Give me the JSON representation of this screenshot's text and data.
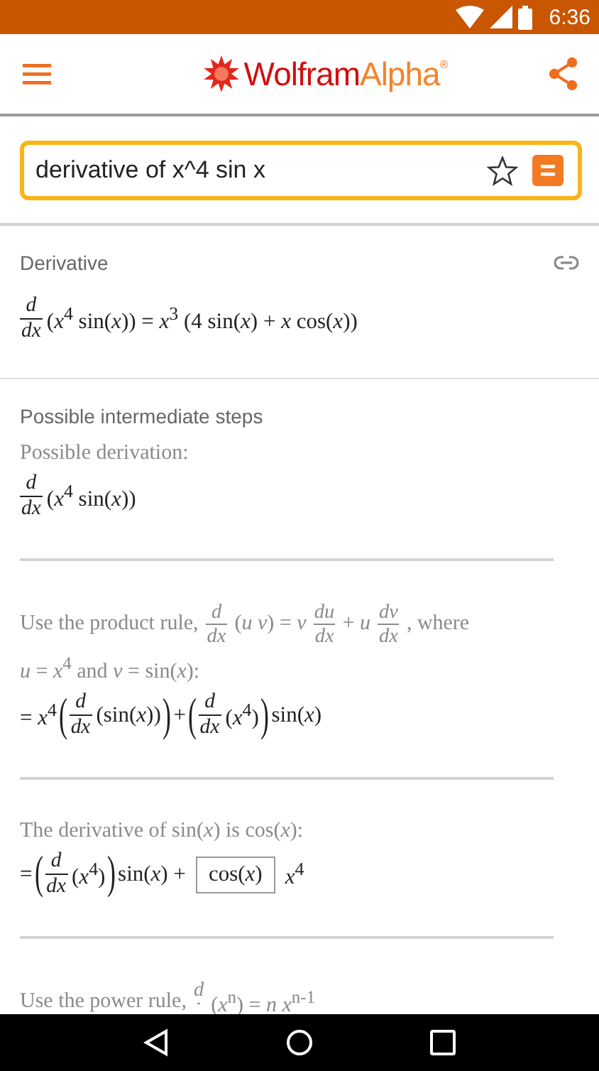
{
  "status_bar": {
    "time": "6:36"
  },
  "app_bar": {
    "logo_first": "Wolfram",
    "logo_second": "Alpha",
    "logo_mark": "®"
  },
  "search": {
    "value": "derivative of x^4 sin x"
  },
  "pods": [
    {
      "title": "Derivative",
      "link": true,
      "lines": [
        {
          "kind": "result",
          "pieces": [
            {
              "kind": "frac",
              "num": "*d*",
              "den": "*dx*"
            },
            {
              "kind": "text",
              "text": "(*x*$^{4}$ sin(*x*)) = *x*$^{3}$ (4 sin(*x*) + *x* cos(*x*))"
            }
          ]
        }
      ]
    },
    {
      "title": "Possible intermediate steps",
      "steps": [
        {
          "lines": [
            {
              "kind": "prose",
              "pieces": [
                {
                  "kind": "text",
                  "text": "Possible derivation:"
                }
              ]
            },
            {
              "kind": "result",
              "pieces": [
                {
                  "kind": "frac",
                  "num": "*d*",
                  "den": "*dx*"
                },
                {
                  "kind": "text",
                  "text": "(*x*$^{4}$ sin(*x*))"
                }
              ]
            }
          ]
        },
        {
          "lines": [
            {
              "kind": "prose",
              "pieces": [
                {
                  "kind": "text",
                  "text": "Use the product rule,"
                },
                {
                  "kind": "frac",
                  "num": "*d*",
                  "den": "*dx*"
                },
                {
                  "kind": "text",
                  "text": "(*u v*) = *v*"
                },
                {
                  "kind": "frac",
                  "num": "*du*",
                  "den": "*dx*"
                },
                {
                  "kind": "text",
                  "text": "+ *u*"
                },
                {
                  "kind": "frac",
                  "num": "*dv*",
                  "den": "*dx*"
                },
                {
                  "kind": "text",
                  "text": ", where"
                }
              ]
            },
            {
              "kind": "prose",
              "pieces": [
                {
                  "kind": "text",
                  "text": "*u* = *x*$^{4}$ and *v* = sin(*x*):"
                }
              ]
            },
            {
              "kind": "result",
              "pieces": [
                {
                  "kind": "text",
                  "text": "= *x*$^{4}$"
                },
                {
                  "kind": "bracket",
                  "text": "("
                },
                {
                  "kind": "frac",
                  "num": "*d*",
                  "den": "*dx*"
                },
                {
                  "kind": "text",
                  "text": "(sin(*x*))"
                },
                {
                  "kind": "bracket",
                  "text": ")"
                },
                {
                  "kind": "text",
                  "text": "+"
                },
                {
                  "kind": "bracket",
                  "text": "("
                },
                {
                  "kind": "frac",
                  "num": "*d*",
                  "den": "*dx*"
                },
                {
                  "kind": "text",
                  "text": "(*x*$^{4}$)"
                },
                {
                  "kind": "bracket",
                  "text": ")"
                },
                {
                  "kind": "text",
                  "text": "sin(*x*)"
                }
              ]
            }
          ]
        },
        {
          "lines": [
            {
              "kind": "prose",
              "pieces": [
                {
                  "kind": "text",
                  "text": "The derivative of sin(*x*) is cos(*x*):"
                }
              ]
            },
            {
              "kind": "result",
              "pieces": [
                {
                  "kind": "text",
                  "text": "="
                },
                {
                  "kind": "bracket",
                  "text": "("
                },
                {
                  "kind": "frac",
                  "num": "*d*",
                  "den": "*dx*"
                },
                {
                  "kind": "text",
                  "text": "(*x*$^{4}$)"
                },
                {
                  "kind": "bracket",
                  "text": ")"
                },
                {
                  "kind": "text",
                  "text": "sin(*x*) +"
                },
                {
                  "kind": "boxed",
                  "text": "cos(*x*)"
                },
                {
                  "kind": "text",
                  "text": "*x*$^{4}$"
                }
              ]
            }
          ]
        },
        {
          "lines": [
            {
              "kind": "prose",
              "pieces": [
                {
                  "kind": "text",
                  "text": "Use the power rule,"
                },
                {
                  "kind": "frac",
                  "num": "*d*"
                },
                {
                  "kind": "text",
                  "text": "(*x*$^{n}$) = *n x*$^{n-1}$"
                }
              ]
            }
          ]
        }
      ]
    }
  ]
}
